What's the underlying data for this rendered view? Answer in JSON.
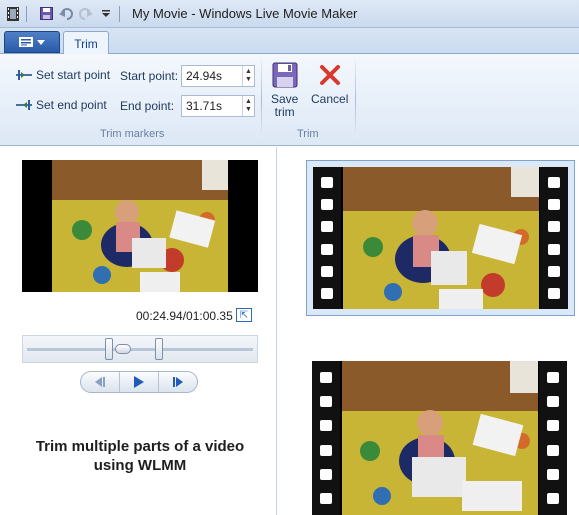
{
  "window": {
    "title": "My Movie - Windows Live Movie Maker"
  },
  "ribbon": {
    "tab_trim": "Trim",
    "set_start_point": "Set start point",
    "set_end_point": "Set end point",
    "start_point_label": "Start point:",
    "start_point_value": "24.94s",
    "end_point_label": "End point:",
    "end_point_value": "31.71s",
    "group_trim_markers": "Trim markers",
    "save_trim_line1": "Save",
    "save_trim_line2": "trim",
    "cancel": "Cancel",
    "group_trim": "Trim"
  },
  "preview": {
    "time": "00:24.94/01:00.35",
    "caption_line1": "Trim multiple parts of a video",
    "caption_line2": "using WLMM"
  },
  "colors": {
    "accent": "#2a5ba8",
    "selected_border": "#7da2ce",
    "cancel_red": "#d9382c"
  },
  "icons": [
    "film-icon",
    "save-icon",
    "undo-icon",
    "redo-icon",
    "dropdown-icon",
    "set-start-icon",
    "set-end-icon",
    "save-trim-icon",
    "cancel-icon",
    "fullscreen-icon",
    "previous-frame-icon",
    "play-icon",
    "next-frame-icon"
  ]
}
